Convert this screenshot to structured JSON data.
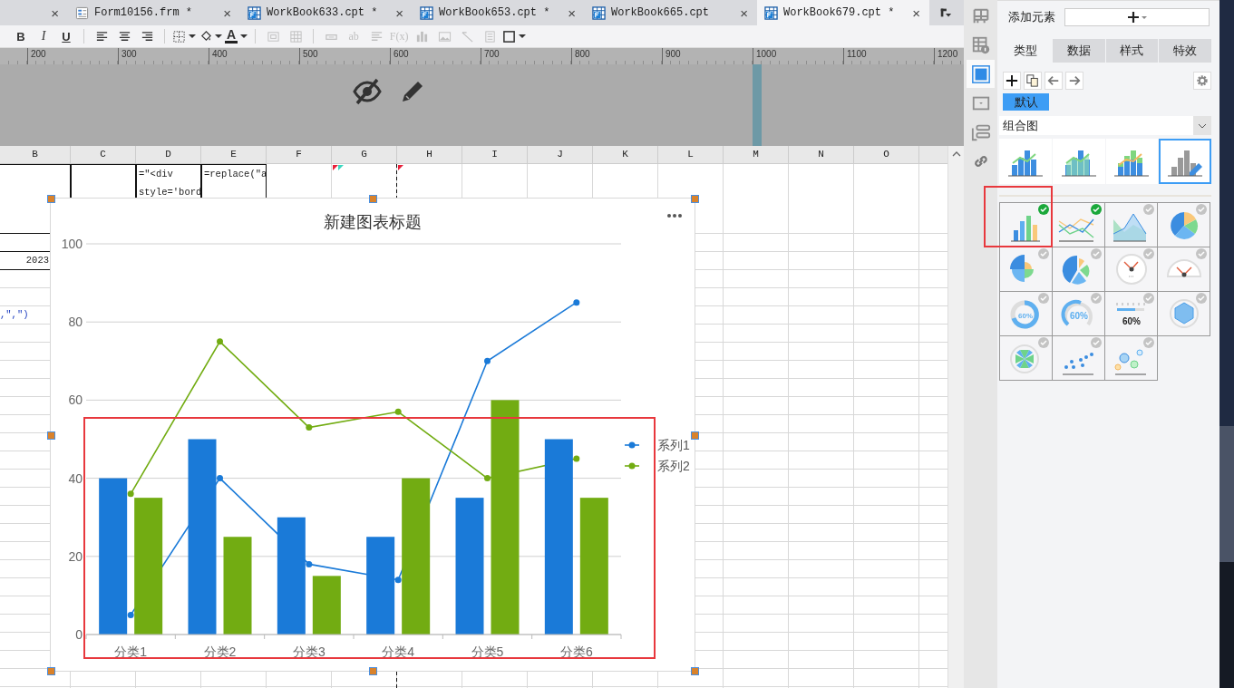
{
  "tabs": [
    {
      "kind": "partial",
      "close": "×",
      "selected": false
    },
    {
      "kind": "form",
      "label": "Form10156.frm *",
      "close": "×",
      "selected": false
    },
    {
      "kind": "workbook",
      "label": "WorkBook633.cpt *",
      "close": "×",
      "selected": false
    },
    {
      "kind": "workbook",
      "label": "WorkBook653.cpt *",
      "close": "×",
      "selected": false
    },
    {
      "kind": "workbook",
      "label": "WorkBook665.cpt",
      "close": "×",
      "selected": false
    },
    {
      "kind": "workbook",
      "label": "WorkBook679.cpt *",
      "close": "×",
      "selected": true
    }
  ],
  "toolbar": [
    {
      "kind": "bold",
      "label": "B",
      "menu": false,
      "disabled": false
    },
    {
      "kind": "italic",
      "label": "I",
      "menu": false,
      "disabled": false
    },
    {
      "kind": "underline",
      "label": "U",
      "menu": false,
      "disabled": false
    },
    {
      "kind": "separator"
    },
    {
      "kind": "align-left",
      "menu": false,
      "disabled": false
    },
    {
      "kind": "align-center",
      "menu": false,
      "disabled": false
    },
    {
      "kind": "align-right",
      "menu": false,
      "disabled": false
    },
    {
      "kind": "separator"
    },
    {
      "kind": "borders",
      "menu": true,
      "disabled": false
    },
    {
      "kind": "fill",
      "menu": true,
      "disabled": false
    },
    {
      "kind": "font-color",
      "label": "A",
      "menu": true,
      "disabled": false
    },
    {
      "kind": "separator"
    },
    {
      "kind": "merge",
      "menu": false,
      "disabled": true
    },
    {
      "kind": "table",
      "menu": false,
      "disabled": true
    },
    {
      "kind": "separator"
    },
    {
      "kind": "field",
      "menu": false,
      "disabled": true
    },
    {
      "kind": "text",
      "label": "ab",
      "menu": false,
      "disabled": true
    },
    {
      "kind": "lines",
      "menu": false,
      "disabled": true
    },
    {
      "kind": "text",
      "label": "F(x)",
      "menu": false,
      "disabled": true
    },
    {
      "kind": "bars",
      "menu": false,
      "disabled": true
    },
    {
      "kind": "image",
      "menu": false,
      "disabled": true
    },
    {
      "kind": "slash",
      "menu": false,
      "disabled": true
    },
    {
      "kind": "document",
      "menu": false,
      "disabled": true
    },
    {
      "kind": "frame",
      "menu": true,
      "disabled": false
    }
  ],
  "ruler": {
    "labels": [
      "200",
      "300",
      "400",
      "500",
      "600",
      "700",
      "800",
      "900",
      "1000",
      "1100",
      "1200"
    ]
  },
  "sheet": {
    "columns": [
      "B",
      "C",
      "D",
      "E",
      "F",
      "G",
      "H",
      "I",
      "J",
      "K",
      "L",
      "M",
      "N",
      "O"
    ],
    "rows": [
      {
        "cells": [
          "",
          "",
          "=\"<div style='bord",
          "=replace(\"a",
          "",
          {
            "kind": "marker-pair"
          },
          {
            "kind": "marker"
          }
        ]
      },
      {
        "cells": [
          ""
        ]
      },
      {
        "cells": [
          {
            "kind": "number",
            "text": "2023"
          }
        ]
      },
      {
        "cells": [
          ""
        ]
      },
      {
        "cells": [
          ""
        ]
      },
      {
        "cells": [
          {
            "kind": "formula",
            "text": ",\",\")"
          }
        ]
      }
    ]
  },
  "chart": {
    "chart_data": {
      "type": "bar",
      "title": "新建图表标题",
      "categories": [
        "分类1",
        "分类2",
        "分类3",
        "分类4",
        "分类5",
        "分类6"
      ],
      "series": [
        {
          "name": "系列1",
          "type": "bar",
          "color": "#1a7ad8",
          "values": [
            40,
            50,
            30,
            25,
            35,
            50
          ]
        },
        {
          "name": "系列2",
          "type": "bar",
          "color": "#72ac12",
          "values": [
            35,
            25,
            15,
            40,
            60,
            35
          ]
        },
        {
          "type": "line",
          "color": "#1a7ad8",
          "marker": true,
          "values": [
            5,
            40,
            18,
            14,
            70,
            85
          ]
        },
        {
          "type": "line",
          "color": "#72ac12",
          "marker": true,
          "values": [
            36,
            75,
            53,
            57,
            40,
            45
          ]
        }
      ],
      "ylim": [
        0,
        100
      ],
      "yticks": [
        0,
        20,
        40,
        60,
        80,
        100
      ],
      "grid": true,
      "legend": true
    }
  },
  "side_icons": [
    {
      "kind": "layout",
      "selected": false
    },
    {
      "kind": "cell-info",
      "selected": false
    },
    {
      "kind": "frame",
      "selected": true
    },
    {
      "kind": "dropdown",
      "selected": false
    },
    {
      "kind": "widget",
      "selected": false
    },
    {
      "kind": "link",
      "selected": false
    }
  ],
  "panel": {
    "add_label": "添加元素",
    "tabs": [
      {
        "label": "类型",
        "selected": true
      },
      {
        "label": "数据",
        "selected": false
      },
      {
        "label": "样式",
        "selected": false
      },
      {
        "label": "特效",
        "selected": false
      }
    ],
    "chip": {
      "label": "默认",
      "selected": true
    },
    "dropdown": {
      "value": "组合图"
    },
    "combo_types": [
      {
        "kind": "bar-line",
        "selected": false
      },
      {
        "kind": "bar-area",
        "selected": false
      },
      {
        "kind": "stacked-line",
        "selected": false
      },
      {
        "kind": "custom",
        "selected": true
      }
    ],
    "chart_types": [
      {
        "kind": "bar",
        "checked": true
      },
      {
        "kind": "line",
        "checked": true
      },
      {
        "kind": "area",
        "checked": false
      },
      {
        "kind": "pie",
        "checked": false
      },
      {
        "kind": "rose",
        "checked": false
      },
      {
        "kind": "donut-pie",
        "checked": false
      },
      {
        "kind": "gauge",
        "checked": false
      },
      {
        "kind": "half-gauge",
        "checked": false
      },
      {
        "kind": "ring",
        "label": "60%",
        "checked": false
      },
      {
        "kind": "arc",
        "label": "60%",
        "checked": false
      },
      {
        "kind": "progress",
        "label": "60%",
        "checked": false
      },
      {
        "kind": "radar",
        "checked": false
      },
      {
        "kind": "wheel",
        "checked": false
      },
      {
        "kind": "scatter",
        "checked": false
      },
      {
        "kind": "bubble",
        "checked": false
      }
    ]
  }
}
